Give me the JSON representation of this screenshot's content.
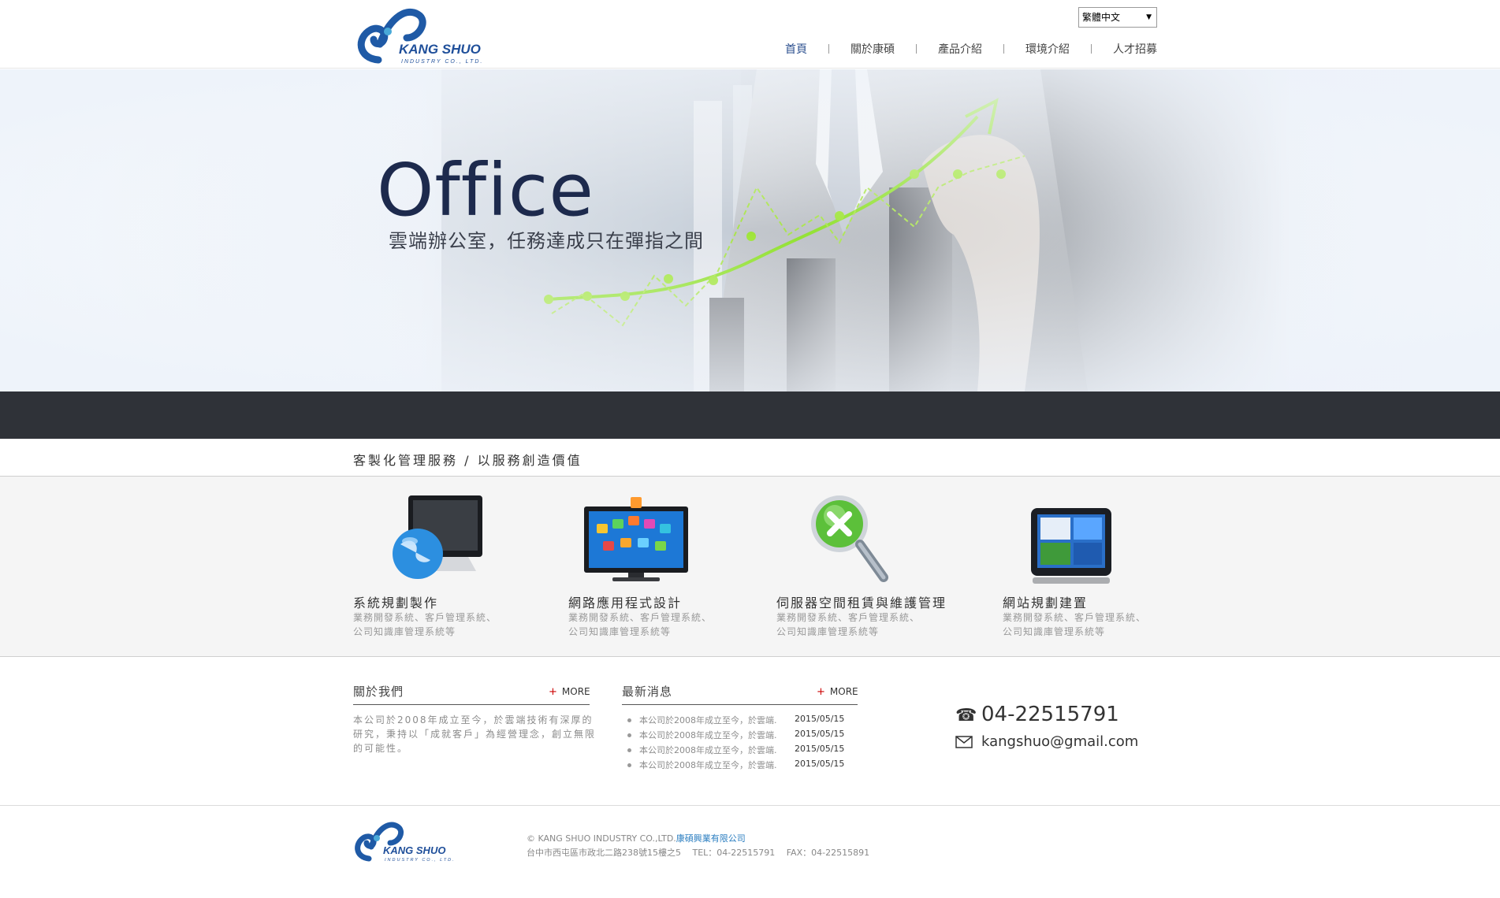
{
  "header": {
    "logo_text": "KANG SHUO",
    "logo_subtext": "INDUSTRY CO., LTD.",
    "language": "繁體中文",
    "nav": [
      {
        "label": "首頁",
        "active": true
      },
      {
        "label": "關於康碩",
        "active": false
      },
      {
        "label": "產品介紹",
        "active": false
      },
      {
        "label": "環境介紹",
        "active": false
      },
      {
        "label": "人才招募",
        "active": false
      }
    ]
  },
  "hero": {
    "title": "Office",
    "subtitle": "雲端辦公室，任務達成只在彈指之間"
  },
  "slogan": "客製化管理服務 / 以服務創造價值",
  "services": [
    {
      "title": "系統規劃製作",
      "desc1": "業務開發系統、客戶管理系統、",
      "desc2": "公司知識庫管理系統等",
      "icon": "monitor-globe-icon"
    },
    {
      "title": "網路應用程式設計",
      "desc1": "業務開發系統、客戶管理系統、",
      "desc2": "公司知識庫管理系統等",
      "icon": "tv-apps-icon"
    },
    {
      "title": "伺服器空間租賃與維護管理",
      "desc1": "業務開發系統、客戶管理系統、",
      "desc2": "公司知識庫管理系統等",
      "icon": "magnifier-icon"
    },
    {
      "title": "網站規劃建置",
      "desc1": "業務開發系統、客戶管理系統、",
      "desc2": "公司知識庫管理系統等",
      "icon": "tablet-icon"
    }
  ],
  "about": {
    "heading": "關於我們",
    "more": "MORE",
    "text": "本公司於2008年成立至今，於雲端技術有深厚的研究，秉持以「成就客戶」為經營理念，創立無限的可能性。"
  },
  "news": {
    "heading": "最新消息",
    "more": "MORE",
    "items": [
      {
        "title": "本公司於2008年成立至今，於雲端.",
        "date": "2015/05/15"
      },
      {
        "title": "本公司於2008年成立至今，於雲端.",
        "date": "2015/05/15"
      },
      {
        "title": "本公司於2008年成立至今，於雲端.",
        "date": "2015/05/15"
      },
      {
        "title": "本公司於2008年成立至今，於雲端.",
        "date": "2015/05/15"
      }
    ]
  },
  "contact": {
    "phone": "04-22515791",
    "email": "kangshuo@gmail.com"
  },
  "footer": {
    "copyright": "© KANG SHUO INDUSTRY CO.,LTD.",
    "company_cn": "康碩興業有限公司",
    "address_line": "台中市西屯區市政北二路238號15樓之5　 TEL：04-22515791　 FAX：04-22515891"
  },
  "colors": {
    "brand_blue": "#1f5aa6",
    "nav_active": "#2b4f8e",
    "dark_band": "#2f3238",
    "chart_green": "#8ee02a"
  }
}
